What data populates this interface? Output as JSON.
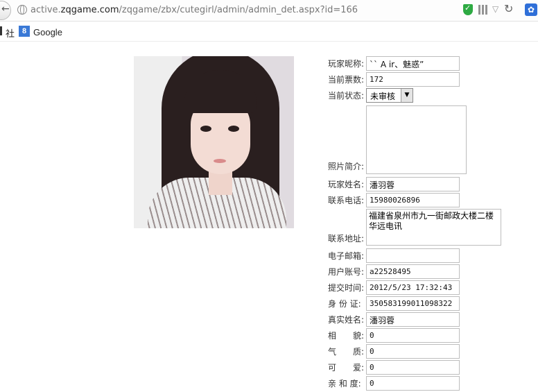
{
  "browser": {
    "url_prefix": "active.",
    "url_domain": "zqgame.com",
    "url_path": "/zqgame/zbx/cutegirl/admin/admin_det.aspx?id=166"
  },
  "bookmarks": {
    "items": [
      {
        "label": "社"
      },
      {
        "label": "Google"
      }
    ]
  },
  "form": {
    "nickname_label": "玩家昵称:",
    "nickname_value": "`` A ir、魅惑”",
    "votes_label": "当前票数:",
    "votes_value": "172",
    "status_label": "当前状态:",
    "status_value": "未审核",
    "intro_label": "照片简介:",
    "intro_value": "",
    "name_label": "玩家姓名:",
    "name_value": "潘羽蓉",
    "phone_label": "联系电话:",
    "phone_value": "15980026896",
    "address_label": "联系地址:",
    "address_value": "福建省泉州市九一街邮政大楼二楼华远电讯",
    "email_label": "电子邮箱:",
    "email_value": "",
    "account_label": "用户账号:",
    "account_value": "a22528495",
    "submit_time_label": "提交时间:",
    "submit_time_value": "2012/5/23 17:32:43",
    "idcard_label": "身 份 证:",
    "idcard_value": "350583199011098322",
    "realname_label": "真实姓名:",
    "realname_value": "潘羽蓉",
    "looks_label": "相　　貌:",
    "looks_value": "0",
    "temperament_label": "气　　质:",
    "temperament_value": "0",
    "cute_label": "可　　爱:",
    "cute_value": "0",
    "affinity_label": "亲 和 度:",
    "affinity_value": "0"
  }
}
